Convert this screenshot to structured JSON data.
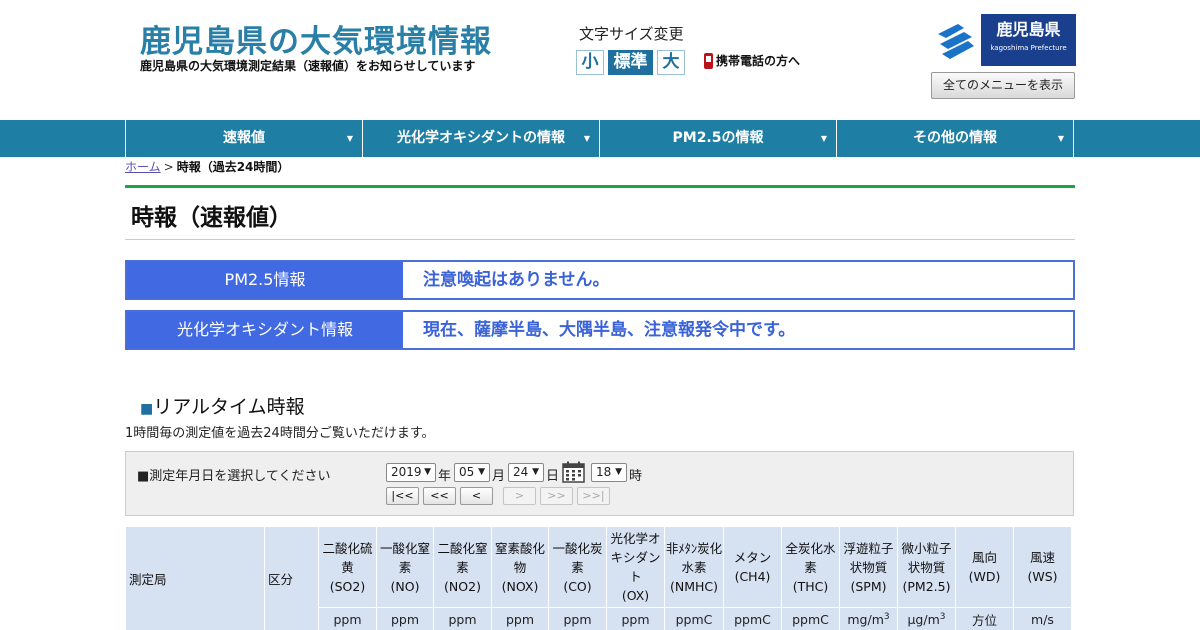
{
  "header": {
    "title": "鹿児島県の大気環境情報",
    "subtitle": "鹿児島県の大気環境測定結果（速報値）をお知らせしています",
    "font_size_label": "文字サイズ変更",
    "font_size_buttons": [
      "小",
      "標準",
      "大"
    ],
    "mobile_link": "携帯電話の方へ",
    "pref_logo_name": "鹿児島県",
    "pref_logo_en": "kagoshima Prefecture",
    "all_menu_button": "全てのメニューを表示"
  },
  "nav": {
    "items": [
      {
        "label": "速報値"
      },
      {
        "label": "光化学オキシダントの情報"
      },
      {
        "label": "PM2.5の情報"
      },
      {
        "label": "その他の情報"
      }
    ]
  },
  "breadcrumb": {
    "home": "ホーム",
    "separator": ">",
    "current": "時報（過去24時間）"
  },
  "page_title": "時報（速報値）",
  "alerts": [
    {
      "label": "PM2.5情報",
      "text": "注意喚起はありません。"
    },
    {
      "label": "光化学オキシダント情報",
      "text": "現在、薩摩半島、大隅半島、注意報発令中です。"
    }
  ],
  "realtime": {
    "title": "リアルタイム時報",
    "title_marker": "■",
    "description": "1時間毎の測定値を過去24時間分ご覧いただけます。"
  },
  "date_selector": {
    "label": "■測定年月日を選択してください",
    "year": "2019",
    "year_unit": "年",
    "month": "05",
    "month_unit": "月",
    "day": "24",
    "day_unit": "日",
    "hour": "18",
    "hour_unit": "時",
    "buttons": {
      "first": "|<<",
      "prev_day": "<<",
      "prev": "<",
      "next": ">",
      "next_day": ">>",
      "last": ">>|"
    }
  },
  "table": {
    "station_header": "測定局",
    "category_header": "区分",
    "columns": [
      {
        "name": "二酸化硫黄",
        "code": "(SO2)",
        "unit": "ppm"
      },
      {
        "name": "一酸化窒素",
        "code": "(NO)",
        "unit": "ppm"
      },
      {
        "name": "二酸化窒素",
        "code": "(NO2)",
        "unit": "ppm"
      },
      {
        "name": "窒素酸化物",
        "code": "(NOX)",
        "unit": "ppm"
      },
      {
        "name": "一酸化炭素",
        "code": "(CO)",
        "unit": "ppm"
      },
      {
        "name": "光化学オキシダント",
        "code": "(OX)",
        "unit": "ppm"
      },
      {
        "name": "非ﾒﾀﾝ炭化水素",
        "code": "(NMHC)",
        "unit": "ppmC"
      },
      {
        "name": "メタン",
        "code": "(CH4)",
        "unit": "ppmC"
      },
      {
        "name": "全炭化水素",
        "code": "(THC)",
        "unit": "ppmC"
      },
      {
        "name": "浮遊粒子状物質",
        "code": "(SPM)",
        "unit": "mg/m3"
      },
      {
        "name": "微小粒子状物質",
        "code": "(PM2.5)",
        "unit": "μg/m3"
      },
      {
        "name": "風向",
        "code": "(WD)",
        "unit": "方位"
      },
      {
        "name": "風速",
        "code": "(WS)",
        "unit": "m/s"
      }
    ]
  },
  "colors": {
    "title_blue": "#2a7fa6",
    "nav_bg": "#1f7ea3",
    "alert_blue": "#4169e1",
    "green_rule": "#1fa34a",
    "table_header_bg": "#d6e1f2"
  }
}
